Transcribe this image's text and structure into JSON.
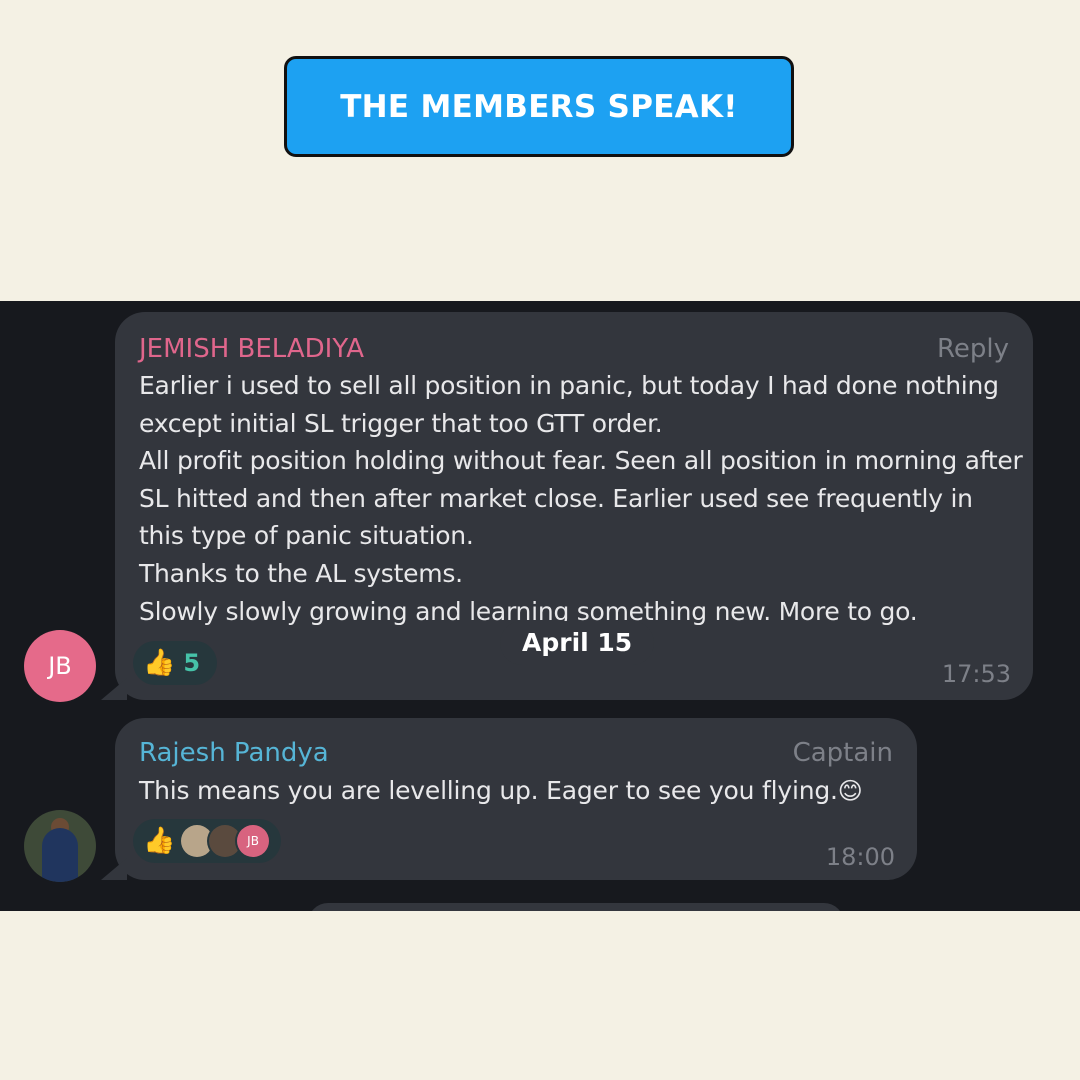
{
  "banner": {
    "title": "THE MEMBERS SPEAK!"
  },
  "chat": {
    "date_pill": "April 15",
    "messages": [
      {
        "sender": "JEMISH BELADIYA",
        "role": "Reply",
        "avatar_initials": "JB",
        "text": "Earlier i used to sell all position in panic, but today I had done nothing except initial SL trigger that too GTT order.\nAll profit position holding without fear. Seen all position in morning after SL hitted and then after market close. Earlier used see frequently in this type of panic situation.\nThanks to the AL systems.\nSlowly slowly growing and learning something new. More to go.",
        "reaction": {
          "icon": "thumbs-up-icon",
          "emoji": "👍",
          "count": "5"
        },
        "time": "17:53"
      },
      {
        "sender": "Rajesh Pandya",
        "role": "Captain",
        "text": "This means you are levelling up. Eager to see you flying.",
        "text_emoji": "😊",
        "reaction": {
          "icon": "thumbs-up-icon",
          "emoji": "👍",
          "reactor_initials": "JB"
        },
        "time": "18:00"
      }
    ]
  },
  "colors": {
    "page_bg": "#f4f1e4",
    "banner_bg": "#1da1f2",
    "chat_bg": "#17191e",
    "bubble_bg": "#33363d",
    "sender1": "#e0668c",
    "sender2": "#56b5d6",
    "reaction_count": "#46c2a8"
  }
}
